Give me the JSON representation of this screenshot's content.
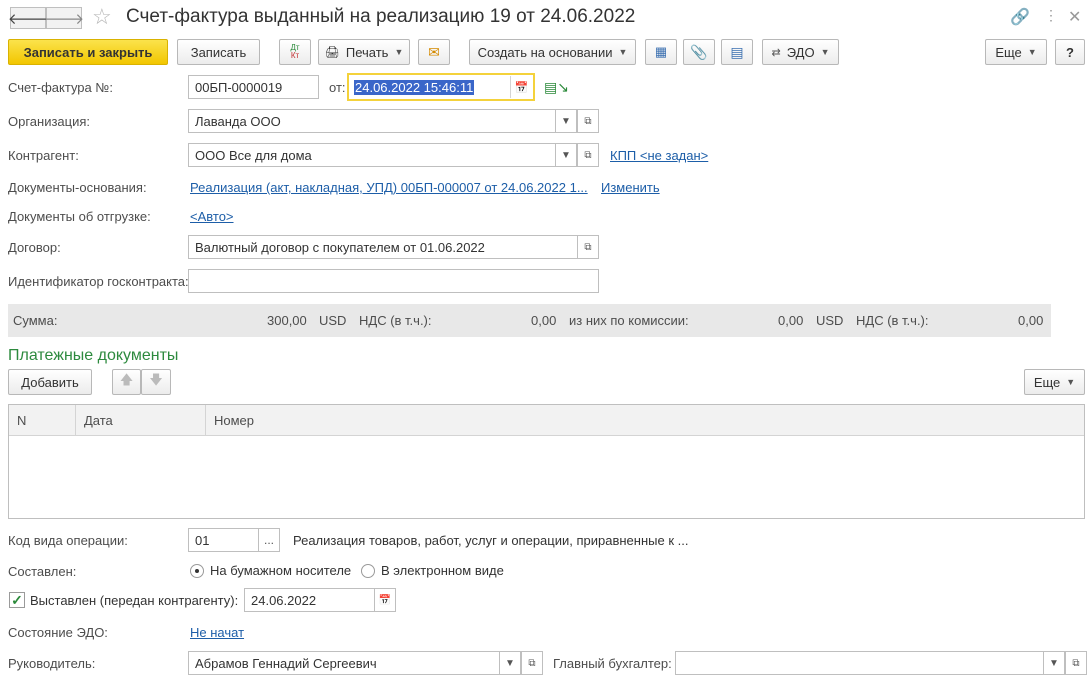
{
  "header": {
    "title": "Счет-фактура выданный на реализацию 19 от 24.06.2022"
  },
  "toolbar": {
    "save_close": "Записать и закрыть",
    "save": "Записать",
    "dt_kt": "Дт Кт",
    "print": "Печать",
    "create_based": "Создать на основании",
    "edo": "ЭДО",
    "more": "Еще"
  },
  "form": {
    "invoice_label": "Счет-фактура №:",
    "invoice_number": "00БП-0000019",
    "from_label": "от:",
    "date_value": "24.06.2022 15:46:11",
    "org_label": "Организация:",
    "org_value": "Лаванда ООО",
    "counterparty_label": "Контрагент:",
    "counterparty_value": "ООО Все для дома",
    "kpp_link": "КПП <не задан>",
    "base_docs_label": "Документы-основания:",
    "base_docs_link": "Реализация (акт, накладная, УПД) 00БП-000007 от 24.06.2022 1...",
    "change_link": "Изменить",
    "shipment_docs_label": "Документы об отгрузке:",
    "shipment_docs_link": "<Авто>",
    "contract_label": "Договор:",
    "contract_value": "Валютный договор с покупателем от 01.06.2022",
    "gov_contract_label": "Идентификатор госконтракта:",
    "gov_contract_value": ""
  },
  "summary": {
    "sum_label": "Сумма:",
    "sum_value": "300,00",
    "currency1": "USD",
    "vat_label1": "НДС (в т.ч.):",
    "vat_value1": "0,00",
    "commission_label": "из них по комиссии:",
    "commission_value": "0,00",
    "currency2": "USD",
    "vat_label2": "НДС (в т.ч.):",
    "vat_value2": "0,00"
  },
  "payments": {
    "title": "Платежные документы",
    "add": "Добавить",
    "more": "Еще",
    "columns": [
      "N",
      "Дата",
      "Номер"
    ]
  },
  "bottom": {
    "op_code_label": "Код вида операции:",
    "op_code_value": "01",
    "op_code_desc": "Реализация товаров, работ, услуг и операции, приравненные к ...",
    "composed_label": "Составлен:",
    "radio_paper": "На бумажном носителе",
    "radio_electronic": "В электронном виде",
    "issued_label": "Выставлен (передан контрагенту):",
    "issued_date": "24.06.2022",
    "edo_state_label": "Состояние ЭДО:",
    "edo_state_link": "Не начат",
    "director_label": "Руководитель:",
    "director_value": "Абрамов Геннадий Сергеевич",
    "accountant_label": "Главный бухгалтер:",
    "accountant_value": ""
  },
  "colors": {
    "primary_button": "#f2c600",
    "link": "#1d5ea8",
    "section_title": "#2d8a3e",
    "date_selection": "#3a66c9"
  }
}
